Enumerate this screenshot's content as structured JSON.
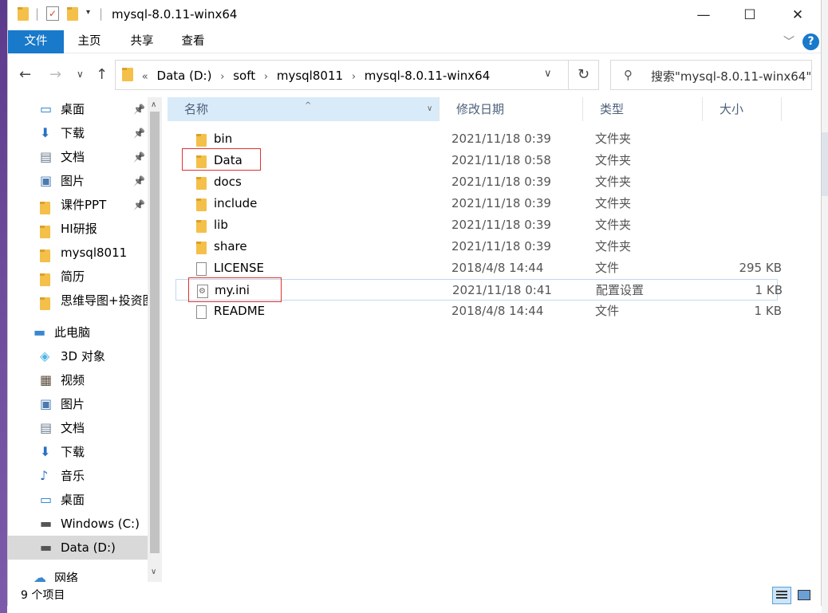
{
  "window": {
    "title": "mysql-8.0.11-winx64",
    "controls": {
      "minimize": "—",
      "maximize": "☐",
      "close": "✕"
    }
  },
  "ribbon": {
    "tabs": [
      "文件",
      "主页",
      "共享",
      "查看"
    ],
    "help": "?"
  },
  "nav": {
    "back": "←",
    "forward": "→",
    "recent": "∨",
    "up": "↑",
    "overflow": "«",
    "breadcrumbs": [
      "Data (D:)",
      "soft",
      "mysql8011",
      "mysql-8.0.11-winx64"
    ],
    "refresh": "↻",
    "search_placeholder": "搜索\"mysql-8.0.11-winx64\""
  },
  "sidebar": {
    "items": [
      {
        "label": "桌面",
        "icon": "desktop-icon",
        "pinned": true
      },
      {
        "label": "下载",
        "icon": "download-icon",
        "pinned": true
      },
      {
        "label": "文档",
        "icon": "documents-icon",
        "pinned": true
      },
      {
        "label": "图片",
        "icon": "pictures-icon",
        "pinned": true
      },
      {
        "label": "课件PPT",
        "icon": "folder-icon",
        "pinned": true
      },
      {
        "label": "HI研报",
        "icon": "folder-icon",
        "pinned": false
      },
      {
        "label": "mysql8011",
        "icon": "folder-icon",
        "pinned": false
      },
      {
        "label": "简历",
        "icon": "folder-icon",
        "pinned": false
      },
      {
        "label": "思维导图+投资图",
        "icon": "folder-icon",
        "pinned": false
      },
      {
        "label": "此电脑",
        "icon": "this-pc-icon",
        "pinned": false
      },
      {
        "label": "3D 对象",
        "icon": "3d-objects-icon",
        "pinned": false
      },
      {
        "label": "视频",
        "icon": "videos-icon",
        "pinned": false
      },
      {
        "label": "图片",
        "icon": "pictures-icon",
        "pinned": false
      },
      {
        "label": "文档",
        "icon": "documents-icon",
        "pinned": false
      },
      {
        "label": "下载",
        "icon": "download-icon",
        "pinned": false
      },
      {
        "label": "音乐",
        "icon": "music-icon",
        "pinned": false
      },
      {
        "label": "桌面",
        "icon": "desktop-icon",
        "pinned": false
      },
      {
        "label": "Windows (C:)",
        "icon": "drive-c-icon",
        "pinned": false
      },
      {
        "label": "Data (D:)",
        "icon": "drive-d-icon",
        "pinned": false,
        "selected": true
      },
      {
        "label": "网络",
        "icon": "network-icon",
        "pinned": false
      }
    ]
  },
  "columns": {
    "name": "名称",
    "date": "修改日期",
    "type": "类型",
    "size": "大小"
  },
  "files": [
    {
      "name": "bin",
      "date": "2021/11/18 0:39",
      "type": "文件夹",
      "size": "",
      "kind": "folder"
    },
    {
      "name": "Data",
      "date": "2021/11/18 0:58",
      "type": "文件夹",
      "size": "",
      "kind": "folder"
    },
    {
      "name": "docs",
      "date": "2021/11/18 0:39",
      "type": "文件夹",
      "size": "",
      "kind": "folder"
    },
    {
      "name": "include",
      "date": "2021/11/18 0:39",
      "type": "文件夹",
      "size": "",
      "kind": "folder"
    },
    {
      "name": "lib",
      "date": "2021/11/18 0:39",
      "type": "文件夹",
      "size": "",
      "kind": "folder"
    },
    {
      "name": "share",
      "date": "2021/11/18 0:39",
      "type": "文件夹",
      "size": "",
      "kind": "folder"
    },
    {
      "name": "LICENSE",
      "date": "2018/4/8 14:44",
      "type": "文件",
      "size": "295 KB",
      "kind": "file"
    },
    {
      "name": "my.ini",
      "date": "2021/11/18 0:41",
      "type": "配置设置",
      "size": "1 KB",
      "kind": "ini"
    },
    {
      "name": "README",
      "date": "2018/4/8 14:44",
      "type": "文件",
      "size": "1 KB",
      "kind": "file"
    }
  ],
  "status": {
    "count": "9 个项目"
  },
  "colors": {
    "accent": "#1979ca",
    "folder": "#f4c04a",
    "highlight_box": "#e0312f",
    "selected_nav": "#d9d9d9"
  }
}
